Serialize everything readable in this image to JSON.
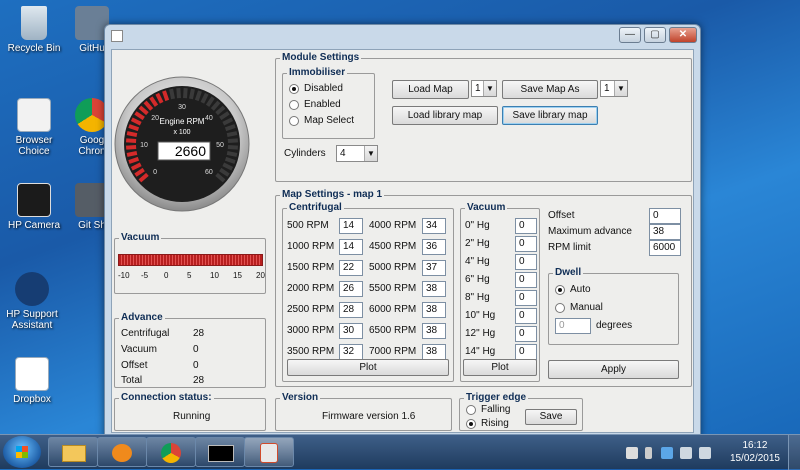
{
  "desktop": {
    "icons": [
      {
        "label_lines": [
          "Recycle Bin"
        ]
      },
      {
        "label_lines": [
          "GitHu"
        ]
      },
      {
        "label_lines": [
          "Browser",
          "Choice"
        ]
      },
      {
        "label_lines": [
          "Goog",
          "Chron"
        ]
      },
      {
        "label_lines": [
          "HP Camera"
        ]
      },
      {
        "label_lines": [
          "Git Sh"
        ]
      },
      {
        "label_lines": [
          "HP Support",
          "Assistant"
        ]
      },
      {
        "label_lines": [
          "Dropbox"
        ]
      }
    ]
  },
  "window": {
    "title_icon": "java-app-icon",
    "controls": {
      "minimize": "—",
      "maximize": "▢",
      "close": "✕"
    }
  },
  "gauge": {
    "title": "Engine RPM",
    "subtitle": "x 100",
    "readout": "2660",
    "ticks": [
      "0",
      "10",
      "20",
      "30",
      "40",
      "50",
      "60"
    ],
    "value_fraction": 0.44,
    "redline_color": "#d42a2a"
  },
  "vacuum_panel": {
    "title": "Vacuum",
    "scale": [
      "-10",
      "-5",
      "0",
      "5",
      "10",
      "15",
      "20"
    ],
    "bar_color": "#cc2a2a"
  },
  "advance_panel": {
    "title": "Advance",
    "rows": [
      {
        "label": "Centrifugal",
        "value": "28"
      },
      {
        "label": "Vacuum",
        "value": "0"
      },
      {
        "label": "Offset",
        "value": "0"
      },
      {
        "label": "Total",
        "value": "28"
      }
    ]
  },
  "module_settings": {
    "title": "Module Settings",
    "immobiliser": {
      "title": "Immobiliser",
      "options": [
        {
          "label": "Disabled",
          "selected": true
        },
        {
          "label": "Enabled",
          "selected": false
        },
        {
          "label": "Map Select",
          "selected": false
        }
      ]
    },
    "load_map_label": "Load Map",
    "load_map_slot": "1",
    "save_map_as_label": "Save Map As",
    "save_map_slot": "1",
    "load_library_label": "Load library map",
    "save_library_label": "Save library map",
    "cylinders_label": "Cylinders",
    "cylinders_value": "4"
  },
  "map_settings": {
    "title": "Map Settings - map 1",
    "centrifugal": {
      "title": "Centrifugal",
      "left": [
        {
          "rpm": "500 RPM",
          "value": "14"
        },
        {
          "rpm": "1000 RPM",
          "value": "14"
        },
        {
          "rpm": "1500 RPM",
          "value": "22"
        },
        {
          "rpm": "2000 RPM",
          "value": "26"
        },
        {
          "rpm": "2500 RPM",
          "value": "28"
        },
        {
          "rpm": "3000 RPM",
          "value": "30"
        },
        {
          "rpm": "3500 RPM",
          "value": "32"
        }
      ],
      "right": [
        {
          "rpm": "4000 RPM",
          "value": "34"
        },
        {
          "rpm": "4500 RPM",
          "value": "36"
        },
        {
          "rpm": "5000 RPM",
          "value": "37"
        },
        {
          "rpm": "5500 RPM",
          "value": "38"
        },
        {
          "rpm": "6000 RPM",
          "value": "38"
        },
        {
          "rpm": "6500 RPM",
          "value": "38"
        },
        {
          "rpm": "7000 RPM",
          "value": "38"
        }
      ],
      "plot_label": "Plot"
    },
    "vacuum": {
      "title": "Vacuum",
      "rows": [
        {
          "hg": "0\" Hg",
          "value": "0"
        },
        {
          "hg": "2\" Hg",
          "value": "0"
        },
        {
          "hg": "4\" Hg",
          "value": "0"
        },
        {
          "hg": "6\" Hg",
          "value": "0"
        },
        {
          "hg": "8\" Hg",
          "value": "0"
        },
        {
          "hg": "10\" Hg",
          "value": "0"
        },
        {
          "hg": "12\" Hg",
          "value": "0"
        },
        {
          "hg": "14\" Hg",
          "value": "0"
        }
      ],
      "plot_label": "Plot"
    },
    "offset_label": "Offset",
    "offset_value": "0",
    "max_advance_label": "Maximum advance",
    "max_advance_value": "38",
    "rpm_limit_label": "RPM limit",
    "rpm_limit_value": "6000",
    "dwell": {
      "title": "Dwell",
      "auto_label": "Auto",
      "manual_label": "Manual",
      "degrees_value": "0",
      "degrees_label": "degrees"
    },
    "apply_label": "Apply"
  },
  "connection": {
    "title": "Connection status:",
    "value": "Running"
  },
  "version": {
    "title": "Version",
    "value": "Firmware version 1.6"
  },
  "trigger": {
    "title": "Trigger edge",
    "falling_label": "Falling",
    "rising_label": "Rising",
    "save_label": "Save"
  },
  "taskbar": {
    "clock_time": "16:12",
    "clock_date": "15/02/2015"
  }
}
